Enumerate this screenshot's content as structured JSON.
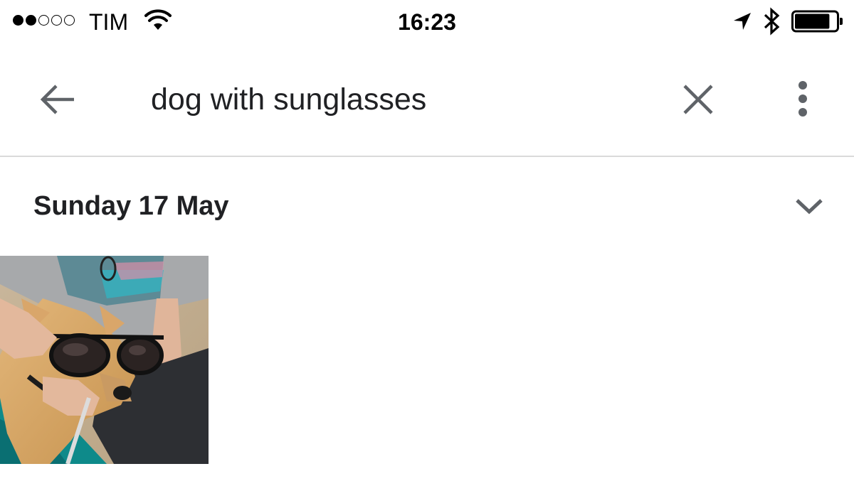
{
  "status_bar": {
    "carrier": "TIM",
    "signal_strength": 2,
    "signal_max": 5,
    "time": "16:23",
    "icons": [
      "signal-dots-icon",
      "wifi-icon",
      "location-arrow-icon",
      "bluetooth-icon",
      "battery-icon"
    ],
    "battery_level": 0.85
  },
  "search_bar": {
    "query": "dog with sunglasses",
    "icons": {
      "back": "arrow-back-icon",
      "clear": "close-icon",
      "more": "more-vertical-icon"
    }
  },
  "results": {
    "groups": [
      {
        "date_label": "Sunday 17 May",
        "expand_icon": "chevron-down-icon",
        "photos": [
          {
            "subject": "photo-thumbnail"
          }
        ]
      }
    ]
  },
  "colors": {
    "icon_gray": "#5f6368",
    "divider": "#dadada",
    "text": "#202124"
  }
}
